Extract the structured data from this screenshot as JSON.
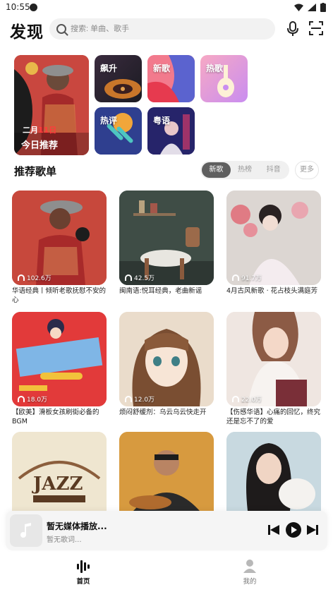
{
  "status": {
    "time": "10:55"
  },
  "header": {
    "title": "发现",
    "search_placeholder": "搜索: 单曲、歌手"
  },
  "discover_tiles": {
    "featured": {
      "date_prefix": "二月",
      "date_highlight": "11日",
      "title": "今日推荐"
    },
    "rising": "飙升",
    "new_songs": "新歌",
    "hot_songs": "热歌",
    "hot_comments": "热评",
    "cantonese": "粤语"
  },
  "section": {
    "title": "推荐歌单",
    "tabs": [
      "新歌",
      "热榜",
      "抖音"
    ],
    "active_tab": "新歌",
    "more_label": "更多"
  },
  "playlists": [
    {
      "count": "102.6万",
      "title": "华语经典丨倾听老歌抚慰不安的心"
    },
    {
      "count": "42.5万",
      "title": "闽南语:悦耳经典，老曲新谣"
    },
    {
      "count": "91.7万",
      "title": "4月古风新歌 · 花占枝头满庭芳"
    },
    {
      "count": "18.0万",
      "title": "【欧美】滑板女孩刷街必备的BGM"
    },
    {
      "count": "12.0万",
      "title": "烦闷舒缓剂：乌云乌云快走开"
    },
    {
      "count": "22.0万",
      "title": "【伤感华语】心痛的回忆，终究还是忘不了的爱"
    },
    {
      "count": "",
      "title": ""
    },
    {
      "count": "",
      "title": ""
    },
    {
      "count": "",
      "title": ""
    }
  ],
  "player": {
    "title": "暂无媒体播放...",
    "lyric": "暂无歌词..."
  },
  "nav": {
    "home": "首页",
    "mine": "我的"
  },
  "colors": {
    "accent": "#111111",
    "tab_active_bg": "#5f5f5f",
    "search_bg": "#f2f2f2"
  }
}
